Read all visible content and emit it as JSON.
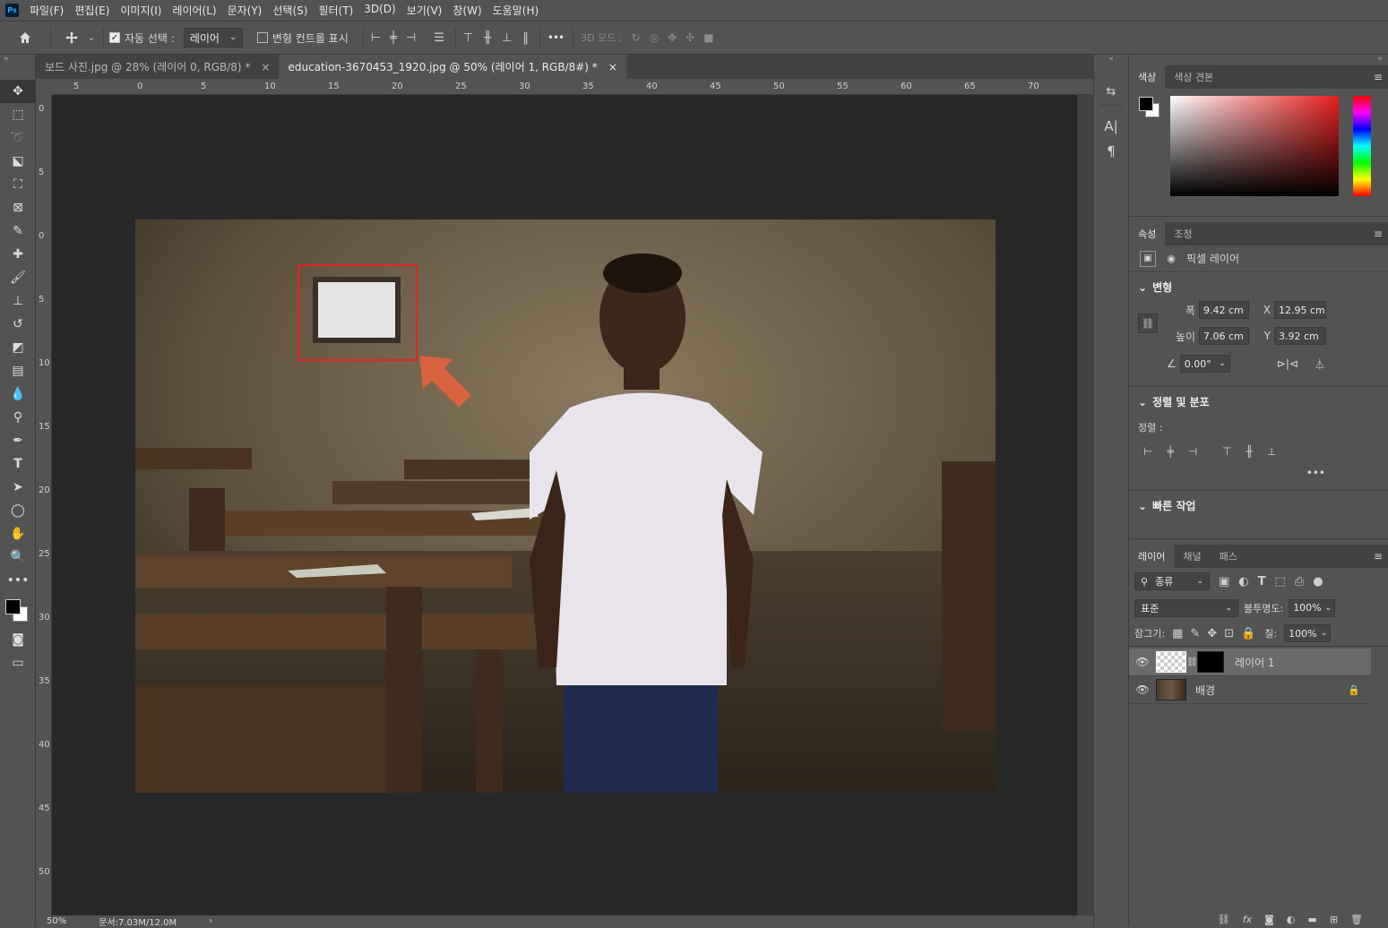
{
  "app": {
    "logo": "Ps"
  },
  "menu": [
    "파일(F)",
    "편집(E)",
    "이미지(I)",
    "레이어(L)",
    "문자(Y)",
    "선택(S)",
    "필터(T)",
    "3D(D)",
    "보기(V)",
    "창(W)",
    "도움말(H)"
  ],
  "options": {
    "auto_select_label": "자동 선택 :",
    "auto_select_value": "레이어",
    "transform_controls_label": "변형 컨트롤 표시",
    "mode_3d_label": "3D 모드 :",
    "more": "•••"
  },
  "tabs": [
    {
      "label": "보드 사진.jpg @ 28% (레이어 0, RGB/8) *",
      "close": "×"
    },
    {
      "label": "education-3670453_1920.jpg @ 50% (레이어 1, RGB/8#) *",
      "close": "×"
    }
  ],
  "ruler_h": [
    "5",
    "0",
    "5",
    "10",
    "15",
    "20",
    "25",
    "30",
    "35",
    "40",
    "45",
    "50",
    "55",
    "60",
    "65",
    "70"
  ],
  "ruler_v": [
    "0",
    "5",
    "0",
    "5",
    "10",
    "15",
    "20",
    "25",
    "30",
    "35",
    "40",
    "45",
    "50"
  ],
  "status": {
    "zoom": "50%",
    "doc": "문서:7.03M/12.0M"
  },
  "color_panel": {
    "tabs": [
      "색상",
      "색상 견본"
    ]
  },
  "properties": {
    "tabs": [
      "속성",
      "조정"
    ],
    "layer_type": "픽셀 레이어",
    "transform_title": "변형",
    "width_label": "폭",
    "width": "9.42 cm",
    "height_label": "높이",
    "height": "7.06 cm",
    "x_label": "X",
    "x": "12.95 cm",
    "y_label": "Y",
    "y": "3.92 cm",
    "angle": "0.00°",
    "align_title": "정렬 및 분포",
    "align_label": "정렬 :",
    "quick_title": "빠른 작업"
  },
  "layers": {
    "tabs": [
      "레이어",
      "채널",
      "패스"
    ],
    "filter_kind": "종류",
    "blend_mode": "표준",
    "opacity_label": "불투명도:",
    "opacity": "100%",
    "lock_label": "잠그기:",
    "fill_label": "칠:",
    "fill": "100%",
    "items": [
      {
        "name": "레이어 1",
        "selected": true
      },
      {
        "name": "배경",
        "selected": false
      }
    ]
  },
  "colors": {
    "accent_red": "#e0242a",
    "arrow": "#d9623f"
  }
}
